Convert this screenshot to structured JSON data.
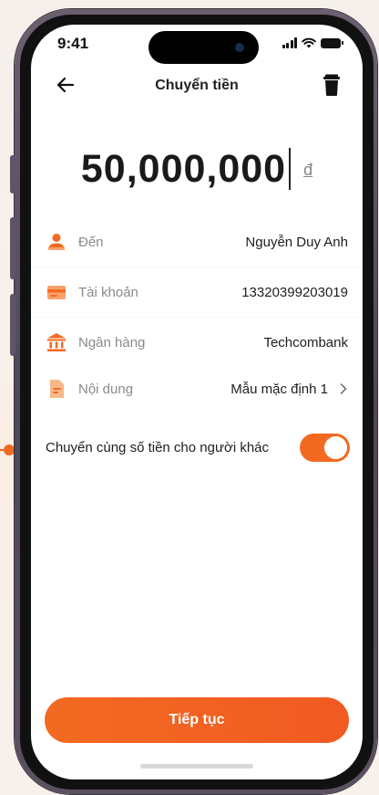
{
  "status_bar": {
    "time": "9:41"
  },
  "header": {
    "title": "Chuyển tiền",
    "back_icon": "arrow-left-icon",
    "delete_icon": "trash-icon"
  },
  "amount": {
    "value": "50,000,000",
    "currency": "đ"
  },
  "details": [
    {
      "icon": "person-icon",
      "label": "Đến",
      "value": "Nguyễn Duy Anh"
    },
    {
      "icon": "card-icon",
      "label": "Tài khoản",
      "value": "13320399203019"
    },
    {
      "icon": "bank-icon",
      "label": "Ngân hàng",
      "value": "Techcombank"
    },
    {
      "icon": "document-icon",
      "label": "Nội dung",
      "value": "Mẫu mặc định 1"
    }
  ],
  "toggle": {
    "label": "Chuyển cùng số tiền cho người khác",
    "on": true
  },
  "cta": {
    "label": "Tiếp tục"
  },
  "colors": {
    "accent": "#F26A21",
    "text": "#1E1E1E",
    "muted": "#8A8A8A"
  }
}
